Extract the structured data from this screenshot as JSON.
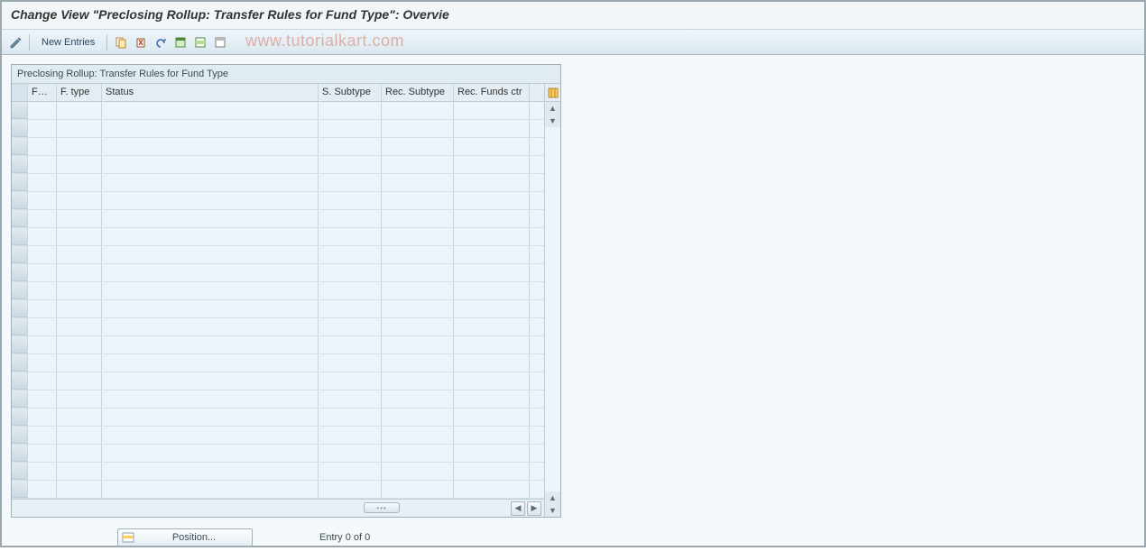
{
  "header": {
    "title": "Change View \"Preclosing Rollup: Transfer Rules for Fund Type\": Overvie"
  },
  "watermark": "www.tutorialkart.com",
  "toolbar": {
    "new_entries_label": "New Entries"
  },
  "panel": {
    "title": "Preclosing Rollup: Transfer Rules for Fund Type"
  },
  "columns": {
    "sel": "",
    "fm": "FM...",
    "ftype": "F. type",
    "status": "Status",
    "s_subtype": "S. Subtype",
    "rec_subtype": "Rec. Subtype",
    "rec_funds_ctr": "Rec. Funds ctr"
  },
  "rows_count": 22,
  "footer": {
    "position_label": "Position...",
    "entry_text": "Entry 0 of 0"
  }
}
